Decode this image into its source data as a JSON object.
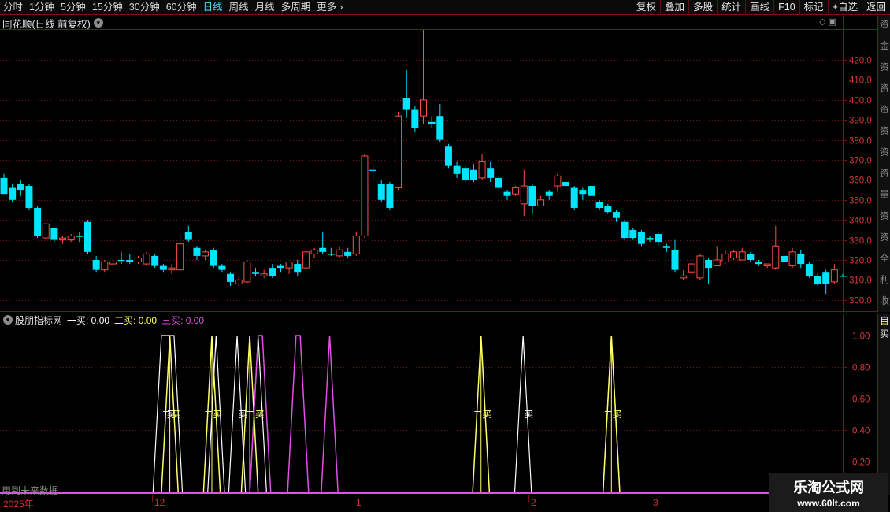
{
  "toolbar": {
    "period_tabs": [
      "分时",
      "1分钟",
      "5分钟",
      "15分钟",
      "30分钟",
      "60分钟",
      "日线",
      "周线",
      "月线",
      "多周期",
      "更多"
    ],
    "active_tab": "日线",
    "right_tools": [
      "复权",
      "叠加",
      "多股",
      "统计",
      "画线",
      "F10",
      "标记",
      "+自选",
      "返回"
    ]
  },
  "title_bar": {
    "stock_title": "同花顺(日线 前复权)"
  },
  "right_strip_chars": [
    "资",
    "金",
    "资",
    "资",
    "资",
    "资",
    "资",
    "资",
    "量",
    "资",
    "资",
    "全",
    "利",
    "收"
  ],
  "indicator": {
    "name": "股朋指标网",
    "items": [
      {
        "label": "一买: 0.00",
        "color": "#ffffff"
      },
      {
        "label": "二买: 0.00",
        "color": "#ffff66"
      },
      {
        "label": "三买: 0.00",
        "color": "#e24fe6"
      }
    ],
    "strip_chars": [
      "自",
      "买"
    ],
    "future_note": "用到未来数据",
    "marker_labels": {
      "one": "一买",
      "two": "二买",
      "three": "三买"
    }
  },
  "date_axis": {
    "labels": [
      "2025年",
      "12",
      "1",
      "2",
      "3"
    ]
  },
  "watermark": {
    "title": "乐淘公式网",
    "url": "www.60lt.com"
  },
  "colors": {
    "up": "#ff4d4d",
    "down": "#00e5ff",
    "buy1": "#ffffff",
    "buy2": "#ffff66",
    "buy3": "#e24fe6",
    "grid": "#7a1414"
  },
  "chart_data": [
    {
      "type": "candlestick",
      "title": "同花顺(日线 前复权)",
      "y_ticks": [
        300.0,
        310.0,
        320.0,
        330.0,
        340.0,
        350.0,
        360.0,
        370.0,
        380.0,
        390.0,
        400.0,
        410.0,
        420.0
      ],
      "ylim": [
        294,
        435
      ],
      "candles": [
        [
          361,
          353,
          363,
          353
        ],
        [
          356,
          350,
          358,
          349
        ],
        [
          358,
          355,
          360,
          352
        ],
        [
          357,
          346,
          358,
          345
        ],
        [
          346,
          332,
          347,
          331
        ],
        [
          331,
          338,
          339,
          330
        ],
        [
          336,
          330,
          336,
          329
        ],
        [
          330,
          331,
          332,
          328
        ],
        [
          330,
          332,
          333,
          329
        ],
        [
          332,
          332,
          334,
          329
        ],
        [
          339,
          324,
          340,
          323
        ],
        [
          320,
          315,
          322,
          314
        ],
        [
          315,
          319,
          320,
          314
        ],
        [
          318,
          319,
          321,
          317
        ],
        [
          320,
          320,
          324,
          318
        ],
        [
          320,
          319,
          323,
          318
        ],
        [
          319,
          321,
          322,
          318
        ],
        [
          318,
          323,
          324,
          317
        ],
        [
          322,
          317,
          323,
          316
        ],
        [
          317,
          315,
          318,
          314
        ],
        [
          315,
          316,
          318,
          313
        ],
        [
          315,
          328,
          333,
          314
        ],
        [
          334,
          330,
          337,
          329
        ],
        [
          326,
          322,
          327,
          320
        ],
        [
          322,
          324,
          325,
          320
        ],
        [
          325,
          317,
          326,
          316
        ],
        [
          317,
          315,
          318,
          314
        ],
        [
          313,
          309,
          314,
          307
        ],
        [
          308,
          310,
          312,
          307
        ],
        [
          309,
          319,
          320,
          308
        ],
        [
          314,
          313,
          316,
          312
        ],
        [
          312,
          313,
          315,
          311
        ],
        [
          316,
          312,
          318,
          311
        ],
        [
          317,
          316,
          318,
          314
        ],
        [
          316,
          319,
          319,
          313
        ],
        [
          318,
          314,
          320,
          312
        ],
        [
          316,
          324,
          325,
          314
        ],
        [
          323,
          325,
          326,
          321
        ],
        [
          326,
          324,
          334,
          323
        ],
        [
          323,
          323,
          326,
          322
        ],
        [
          322,
          325,
          327,
          321
        ],
        [
          324,
          322,
          326,
          321
        ],
        [
          323,
          332,
          334,
          322
        ],
        [
          332,
          372,
          373,
          331
        ],
        [
          365,
          365,
          367,
          360
        ],
        [
          358,
          350,
          360,
          349
        ],
        [
          358,
          346,
          359,
          345
        ],
        [
          356,
          392,
          394,
          355
        ],
        [
          401,
          395,
          415,
          391
        ],
        [
          395,
          386,
          397,
          384
        ],
        [
          392,
          400,
          435,
          388
        ],
        [
          389,
          388,
          392,
          386
        ],
        [
          392,
          380,
          398,
          379
        ],
        [
          377,
          367,
          378,
          366
        ],
        [
          367,
          363,
          369,
          361
        ],
        [
          366,
          360,
          367,
          359
        ],
        [
          365,
          360,
          368,
          359
        ],
        [
          361,
          369,
          373,
          360
        ],
        [
          366,
          361,
          369,
          359
        ],
        [
          361,
          356,
          362,
          355
        ],
        [
          354,
          352,
          355,
          350
        ],
        [
          353,
          356,
          357,
          352
        ],
        [
          348,
          357,
          365,
          342
        ],
        [
          357,
          347,
          358,
          343
        ],
        [
          347,
          350,
          352,
          348
        ],
        [
          354,
          352,
          355,
          350
        ],
        [
          357,
          362,
          363,
          354
        ],
        [
          359,
          357,
          360,
          354
        ],
        [
          356,
          346,
          357,
          345
        ],
        [
          355,
          353,
          356,
          350
        ],
        [
          357,
          352,
          358,
          351
        ],
        [
          349,
          346,
          350,
          345
        ],
        [
          347,
          344,
          348,
          343
        ],
        [
          344,
          341,
          345,
          339
        ],
        [
          339,
          331,
          340,
          330
        ],
        [
          335,
          331,
          336,
          330
        ],
        [
          334,
          328,
          335,
          327
        ],
        [
          331,
          330,
          332,
          329
        ],
        [
          333,
          329,
          334,
          327
        ],
        [
          327,
          326,
          328,
          324
        ],
        [
          325,
          315,
          330,
          314
        ],
        [
          311,
          312,
          315,
          310
        ],
        [
          314,
          318,
          319,
          313
        ],
        [
          311,
          322,
          323,
          310
        ],
        [
          320,
          316,
          321,
          308
        ],
        [
          317,
          320,
          327,
          317
        ],
        [
          319,
          323,
          325,
          318
        ],
        [
          321,
          324,
          325,
          320
        ],
        [
          320,
          324,
          326,
          320
        ],
        [
          323,
          320,
          324,
          319
        ],
        [
          319,
          318,
          320,
          317
        ],
        [
          317,
          318,
          318,
          316
        ],
        [
          316,
          327,
          337,
          315
        ],
        [
          322,
          319,
          323,
          318
        ],
        [
          317,
          324,
          326,
          316
        ],
        [
          323,
          318,
          325,
          316
        ],
        [
          318,
          312,
          319,
          311
        ],
        [
          312,
          308,
          313,
          307
        ],
        [
          314,
          308,
          315,
          303
        ],
        [
          309,
          315,
          318,
          308
        ],
        [
          312,
          312,
          313,
          312
        ]
      ]
    },
    {
      "type": "line",
      "title": "股朋指标网",
      "y_ticks": [
        0.2,
        0.4,
        0.6,
        0.8,
        1.0
      ],
      "ylim": [
        0,
        1.05
      ],
      "series": [
        {
          "name": "一买",
          "color": "#ffffff",
          "peaks": [
            [
              38,
              41
            ],
            [
              51,
              51
            ],
            [
              56,
              56
            ],
            [
              61,
              61
            ],
            [
              124,
              124
            ],
            [
              145,
              145
            ]
          ]
        },
        {
          "name": "二买",
          "color": "#ffff66",
          "peaks": [
            [
              40,
              40
            ],
            [
              50,
              50
            ],
            [
              59,
              59
            ],
            [
              114,
              114
            ],
            [
              145,
              145
            ]
          ]
        },
        {
          "name": "三买",
          "color": "#e24fe6",
          "peaks": [
            [
              61,
              62
            ],
            [
              70,
              71
            ],
            [
              78,
              78
            ]
          ]
        }
      ]
    }
  ]
}
